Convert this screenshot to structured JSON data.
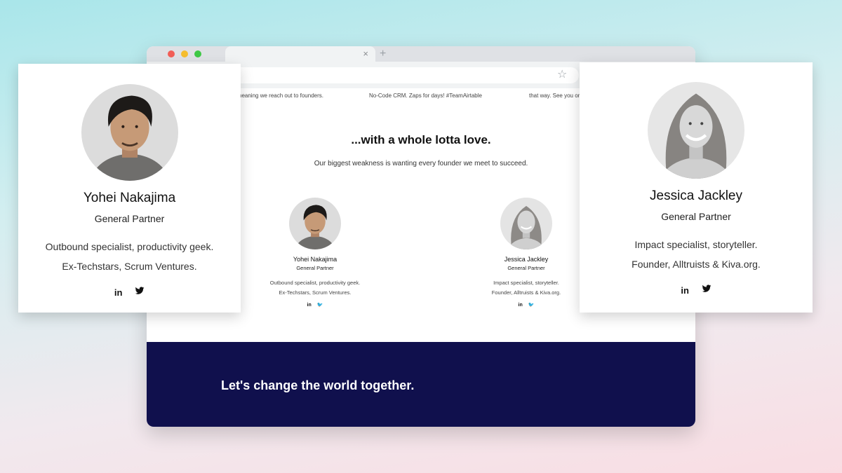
{
  "browser": {
    "tab_close": "×",
    "tab_new": "+",
    "star": "☆"
  },
  "page": {
    "ticker_left": "und, meaning we reach out to founders.",
    "ticker_mid": "No-Code CRM. Zaps for days! #TeamAirtable",
    "ticker_right": "that way. See you on Z",
    "headline": "...with a whole lotta love.",
    "subline": "Our biggest weakness is wanting every founder we meet to succeed.",
    "banner": "Let's change the world together."
  },
  "people": [
    {
      "name": "Yohei Nakajima",
      "role": "General Partner",
      "line1": "Outbound specialist, productivity geek.",
      "line2": "Ex-Techstars, Scrum Ventures.",
      "linkedin": "in",
      "twitter": "🐦"
    },
    {
      "name": "Jessica Jackley",
      "role": "General Partner",
      "line1": "Impact specialist, storyteller.",
      "line2": "Founder, Alltruists & Kiva.org.",
      "linkedin": "in",
      "twitter": "🐦"
    }
  ],
  "icons": {
    "linkedin": "linkedin-icon",
    "twitter": "twitter-icon"
  }
}
